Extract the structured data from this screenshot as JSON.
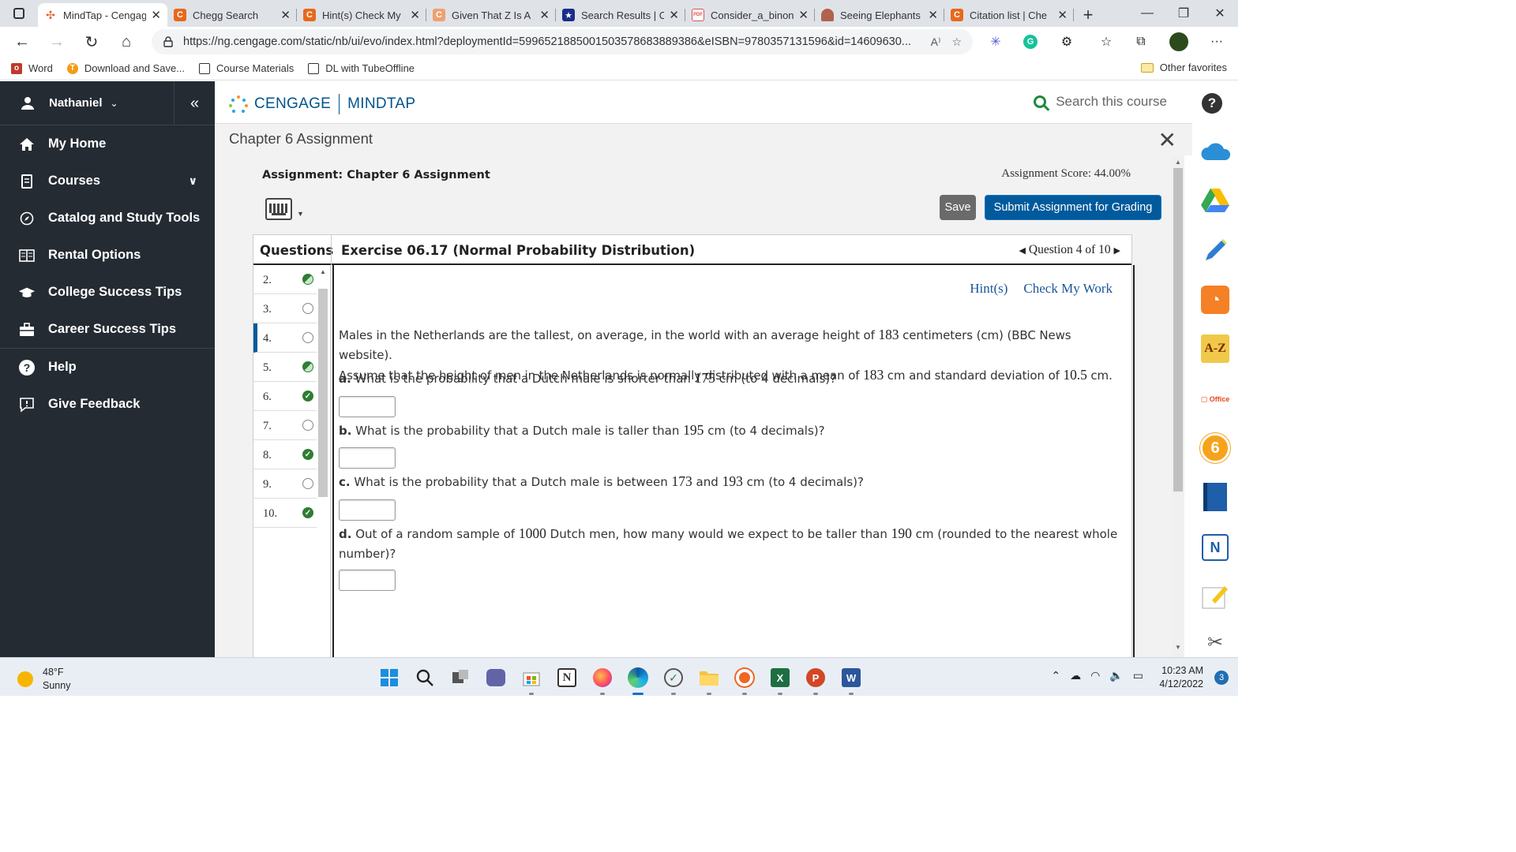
{
  "browser": {
    "tabs": [
      {
        "title": "MindTap - Cengage",
        "fav": "cengage-dots",
        "fav_color": "#e85c2b",
        "active": true
      },
      {
        "title": "Chegg Search",
        "fav": "C",
        "fav_color": "#e8681c"
      },
      {
        "title": "Hint(s) Check My",
        "fav": "C",
        "fav_color": "#e8681c"
      },
      {
        "title": "Given That Z Is A",
        "fav": "C",
        "fav_color": "#f0a070"
      },
      {
        "title": "Search Results | C",
        "fav": "★",
        "fav_color": "#1b2d8a"
      },
      {
        "title": "Consider_a_binon",
        "fav": "PDF",
        "fav_color": "#d9534f"
      },
      {
        "title": "Seeing Elephants",
        "fav": "img",
        "fav_color": "#b0624c"
      },
      {
        "title": "Citation list | Che",
        "fav": "C",
        "fav_color": "#e8681c"
      }
    ],
    "url": "https://ng.cengage.com/static/nb/ui/evo/index.html?deploymentId=5996521885001503578683889386&eISBN=9780357131596&id=14609630...",
    "bookmarks": [
      {
        "label": "Word",
        "icon_color": "#c0392b"
      },
      {
        "label": "Download and Save...",
        "icon_color": "#f39c12"
      },
      {
        "label": "Course Materials",
        "icon_color": "#ffffff"
      },
      {
        "label": "DL with TubeOffline",
        "icon_color": "#ffffff"
      }
    ],
    "other_favorites": "Other favorites"
  },
  "sidebar": {
    "user": "Nathaniel",
    "items": [
      {
        "label": "My Home",
        "icon": "home-icon"
      },
      {
        "label": "Courses",
        "icon": "book-icon",
        "expandable": true
      },
      {
        "label": "Catalog and Study Tools",
        "icon": "compass-icon"
      },
      {
        "label": "Rental Options",
        "icon": "book-open-icon"
      },
      {
        "label": "College Success Tips",
        "icon": "graduation-cap-icon"
      },
      {
        "label": "Career Success Tips",
        "icon": "briefcase-icon"
      },
      {
        "label": "Help",
        "icon": "help-circle-icon"
      },
      {
        "label": "Give Feedback",
        "icon": "feedback-icon"
      }
    ]
  },
  "header": {
    "brand_left": "CENGAGE",
    "brand_right": "MINDTAP",
    "search_placeholder": "Search this course"
  },
  "chapter_title": "Chapter 6 Assignment",
  "assignment": {
    "title": "Assignment: Chapter 6 Assignment",
    "score": "Assignment Score: 44.00%",
    "save_label": "Save",
    "submit_label": "Submit Assignment for Grading"
  },
  "questions_panel": {
    "label": "Questions",
    "exercise_title": "Exercise 06.17 (Normal Probability Distribution)",
    "nav": "Question 4 of 10",
    "list": [
      {
        "n": "2.",
        "status": "partial"
      },
      {
        "n": "3.",
        "status": "empty"
      },
      {
        "n": "4.",
        "status": "empty",
        "current": true
      },
      {
        "n": "5.",
        "status": "partial"
      },
      {
        "n": "6.",
        "status": "complete"
      },
      {
        "n": "7.",
        "status": "empty"
      },
      {
        "n": "8.",
        "status": "complete"
      },
      {
        "n": "9.",
        "status": "empty"
      },
      {
        "n": "10.",
        "status": "complete"
      }
    ]
  },
  "question": {
    "hints_label": "Hint(s)",
    "check_label": "Check My Work",
    "intro_1": "Males in the Netherlands are the tallest, on average, in the world with an average height of",
    "intro_num_1": "183",
    "intro_2": "centimeters (cm) (BBC News website).",
    "intro_3": "Assume that the height of men in the Netherlands is normally distributed with a mean of",
    "intro_num_2": "183",
    "intro_4": "cm and standard deviation of",
    "intro_num_3": "10.5",
    "intro_5": "cm.",
    "parts": [
      {
        "label": "a.",
        "pre": "What is the probability that a Dutch male is shorter than",
        "num": "175",
        "post": "cm (to 4 decimals)?",
        "answer": ""
      },
      {
        "label": "b.",
        "pre": "What is the probability that a Dutch male is taller than",
        "num": "195",
        "post": "cm (to 4 decimals)?",
        "answer": ""
      },
      {
        "label": "c.",
        "pre": "What is the probability that a Dutch male is between",
        "num": "173",
        "mid": "and",
        "num2": "193",
        "post": "cm (to 4 decimals)?",
        "answer": ""
      },
      {
        "label": "d.",
        "pre": "Out of a random sample of",
        "num": "1000",
        "mid": "Dutch men, how many would we expect to be taller than",
        "num2": "190",
        "post": "cm (rounded to the nearest whole",
        "post2": "number)?",
        "answer": ""
      }
    ]
  },
  "taskbar": {
    "temp": "48°F",
    "condition": "Sunny",
    "time": "10:23 AM",
    "date": "4/12/2022",
    "notifications": "3"
  }
}
